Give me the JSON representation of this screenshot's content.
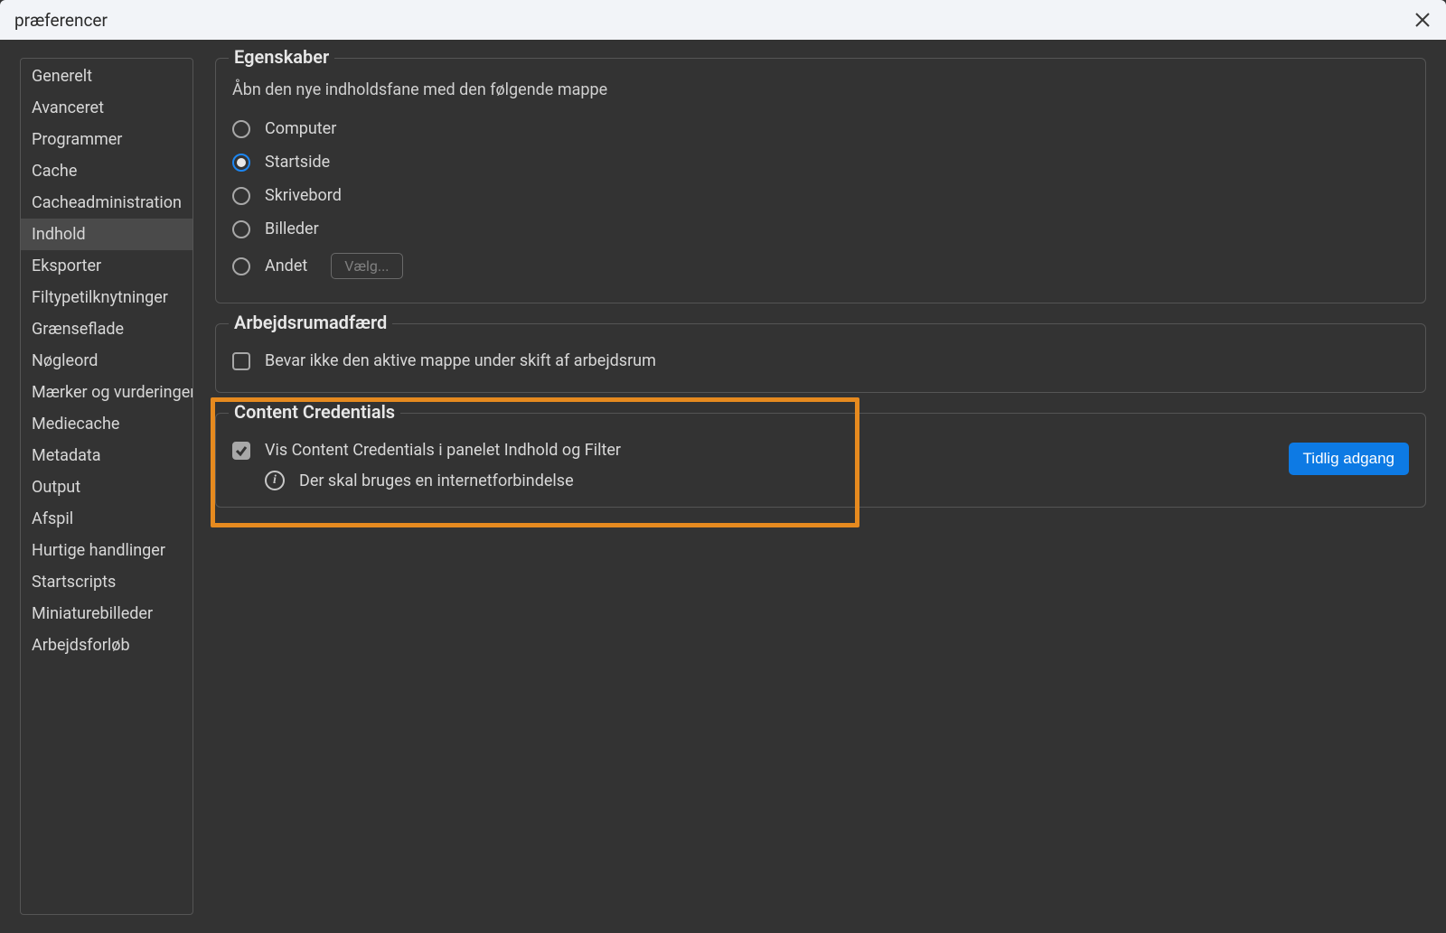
{
  "window": {
    "title": "præferencer"
  },
  "sidebar": {
    "items": [
      {
        "label": "Generelt",
        "selected": false
      },
      {
        "label": "Avanceret",
        "selected": false
      },
      {
        "label": "Programmer",
        "selected": false
      },
      {
        "label": "Cache",
        "selected": false
      },
      {
        "label": "Cacheadministration",
        "selected": false
      },
      {
        "label": "Indhold",
        "selected": true
      },
      {
        "label": "Eksporter",
        "selected": false
      },
      {
        "label": "Filtypetilknytninger",
        "selected": false
      },
      {
        "label": "Grænseflade",
        "selected": false
      },
      {
        "label": "Nøgleord",
        "selected": false
      },
      {
        "label": "Mærker og vurderinger",
        "selected": false
      },
      {
        "label": "Mediecache",
        "selected": false
      },
      {
        "label": "Metadata",
        "selected": false
      },
      {
        "label": "Output",
        "selected": false
      },
      {
        "label": "Afspil",
        "selected": false
      },
      {
        "label": "Hurtige handlinger",
        "selected": false
      },
      {
        "label": "Startscripts",
        "selected": false
      },
      {
        "label": "Miniaturebilleder",
        "selected": false
      },
      {
        "label": "Arbejdsforløb",
        "selected": false
      }
    ]
  },
  "properties": {
    "legend": "Egenskaber",
    "subtext": "Åbn den nye indholdsfane med den følgende mappe",
    "radios": [
      {
        "label": "Computer",
        "selected": false
      },
      {
        "label": "Startside",
        "selected": true
      },
      {
        "label": "Skrivebord",
        "selected": false
      },
      {
        "label": "Billeder",
        "selected": false
      },
      {
        "label": "Andet",
        "selected": false,
        "has_choose": true
      }
    ],
    "choose_label": "Vælg..."
  },
  "workspace": {
    "legend": "Arbejdsrumadfærd",
    "checkbox_label": "Bevar ikke den aktive mappe under skift af arbejdsrum",
    "checked": false
  },
  "content_credentials": {
    "legend": "Content Credentials",
    "checkbox_label": "Vis Content Credentials i panelet Indhold og Filter",
    "checked": true,
    "info_text": "Der skal bruges en internetforbindelse",
    "early_access_label": "Tidlig adgang"
  }
}
